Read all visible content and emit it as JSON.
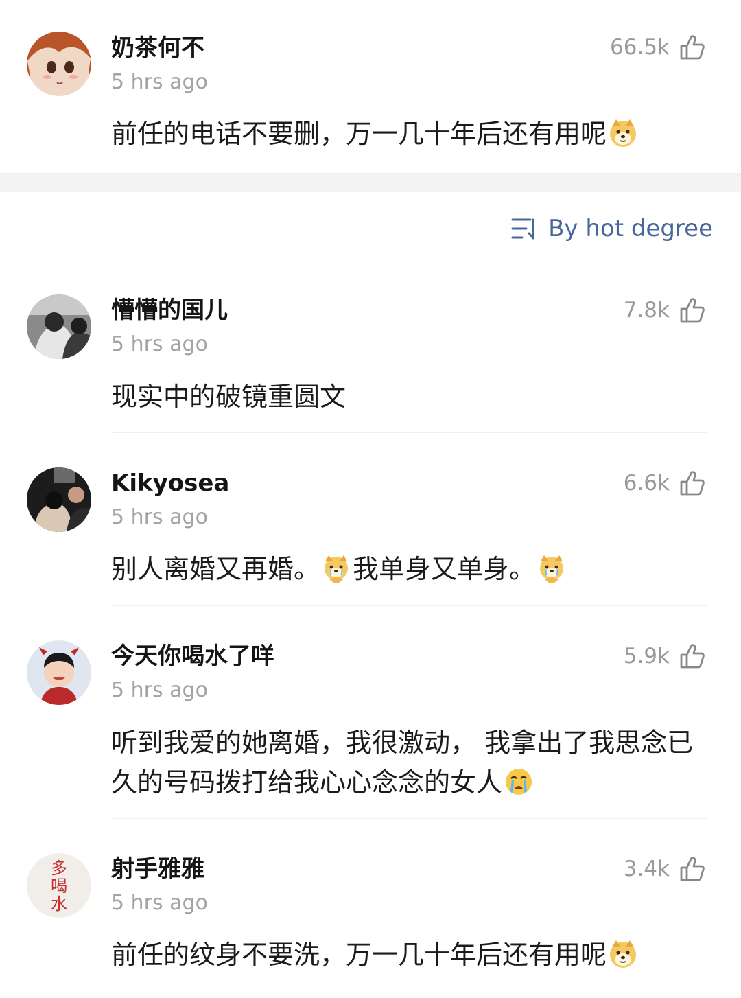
{
  "top_comment": {
    "username": "奶茶何不",
    "time": "5 hrs ago",
    "likes": "66.5k",
    "text": "前任的电话不要删，万一几十年后还有用呢",
    "trailing_emoji": "doge-emoji"
  },
  "sort": {
    "label": "By hot degree",
    "icon": "sort-icon"
  },
  "comments": [
    {
      "username": "懵懵的国儿",
      "time": "5 hrs ago",
      "likes": "7.8k",
      "text": "现实中的破镜重圆文"
    },
    {
      "username": "Kikyosea",
      "time": "5 hrs ago",
      "likes": "6.6k",
      "text_part1": "别人离婚又再婚。",
      "text_part2": "我单身又单身。",
      "emoji": "crying-dog-emoji"
    },
    {
      "username": "今天你喝水了咩",
      "time": "5 hrs ago",
      "likes": "5.9k",
      "text": "听到我爱的她离婚，我很激动， 我拿出了我思念已久的号码拨打给我心心念念的女人",
      "trailing_emoji": "crying-face-emoji"
    },
    {
      "username": "射手雅雅",
      "time": "5 hrs ago",
      "likes": "3.4k",
      "text": "前任的纹身不要洗，万一几十年后还有用呢",
      "trailing_emoji": "doge-emoji",
      "avatar_text": [
        "多",
        "喝",
        "水"
      ]
    }
  ],
  "colors": {
    "username": "#151515",
    "meta": "#a3a3a3",
    "accent": "#47679b",
    "band": "#f3f3f3"
  }
}
